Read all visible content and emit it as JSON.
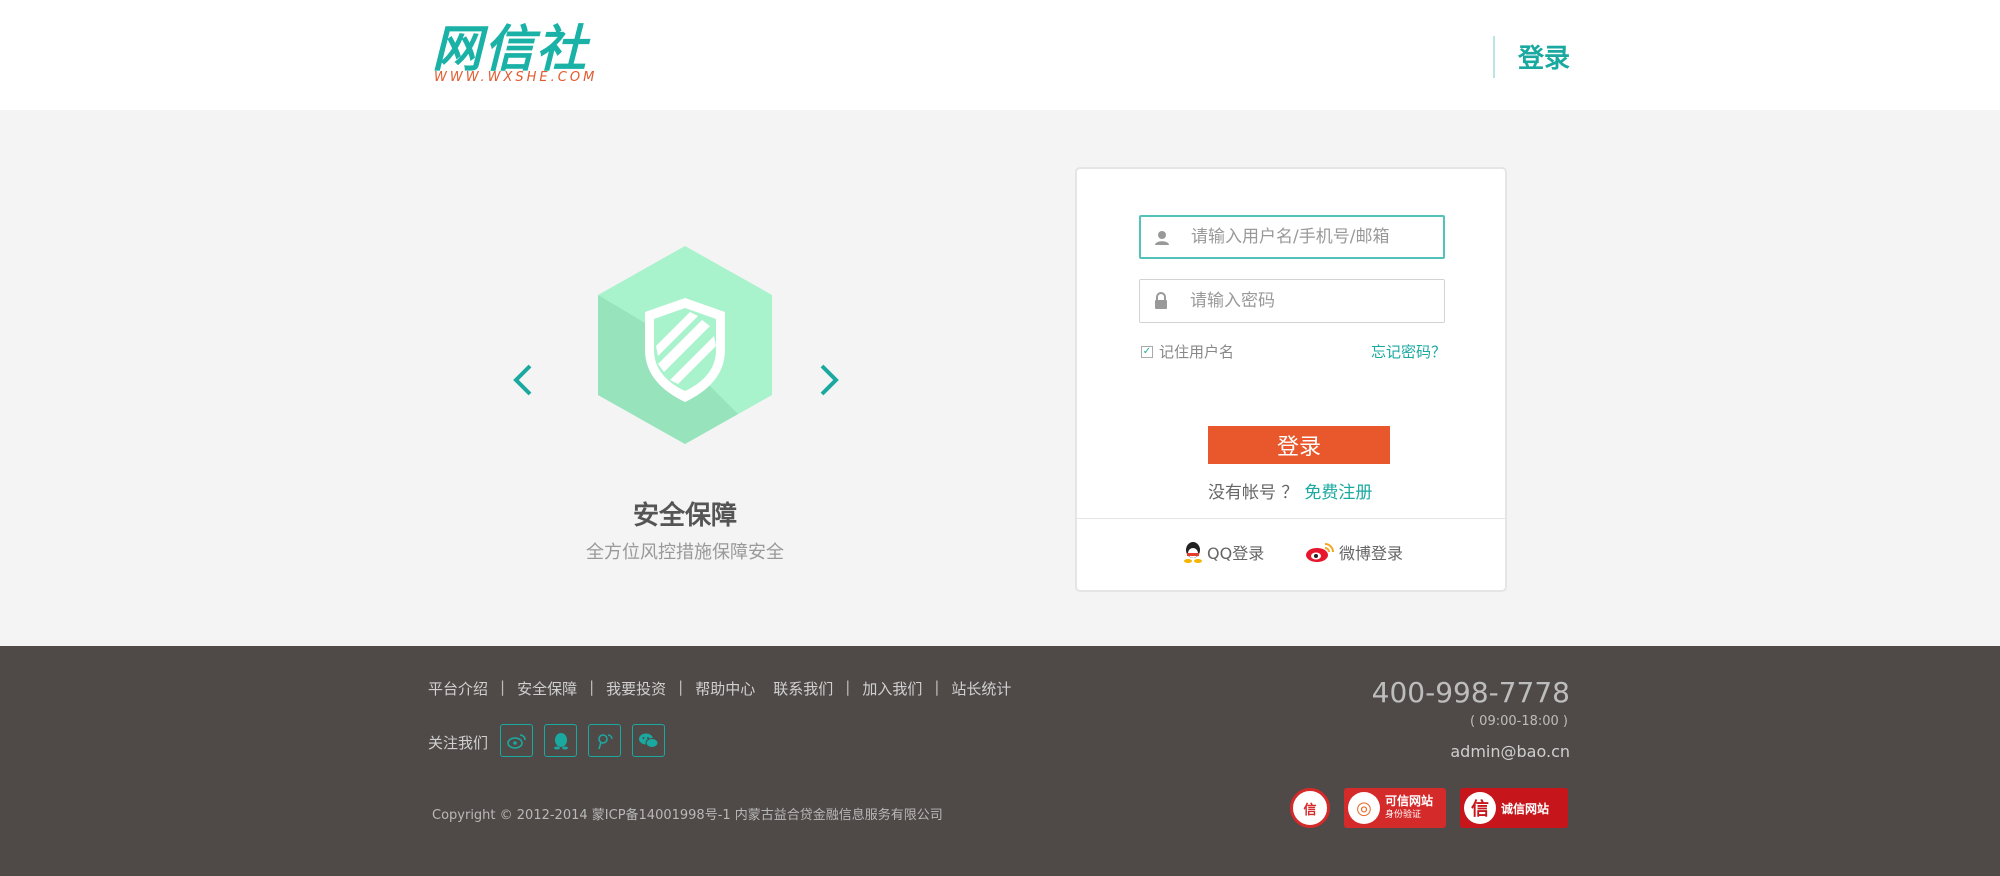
{
  "header": {
    "logo_text": "网信社",
    "logo_url_text": "WWW.WXSHE.COM",
    "login_label": "登录"
  },
  "slider": {
    "icon": "shield-icon",
    "title": "安全保障",
    "description": "全方位风控措施保障安全"
  },
  "login": {
    "username_placeholder": "请输入用户名/手机号/邮箱",
    "password_placeholder": "请输入密码",
    "remember_label": "记住用户名",
    "forgot_label": "忘记密码？",
    "submit_label": "登录",
    "no_account_text": "没有帐号 ？",
    "register_label": "免费注册",
    "qq_login_label": "QQ登录",
    "weibo_login_label": "微博登录"
  },
  "footer": {
    "nav": [
      "平台介绍",
      "安全保障",
      "我要投资",
      "帮助中心",
      "联系我们",
      "加入我们",
      "站长统计"
    ],
    "follow_label": "关注我们",
    "follow_icons": [
      "weibo-icon",
      "qq-icon",
      "tencent-weibo-icon",
      "wechat-icon"
    ],
    "copyright": "Copyright © 2012-2014 蒙ICP备14001998号-1 内蒙古益合贷金融信息服务有限公司",
    "phone": "400-998-7778",
    "hours": "( 09:00-18:00 )",
    "email": "admin@bao.cn",
    "badges": {
      "trust_text": "信",
      "credible_title": "可信网站",
      "credible_sub": "身份验证",
      "integrity_icon_text": "信",
      "integrity_title": "诚信网站"
    }
  },
  "colors": {
    "brand": "#1aa9a0",
    "button": "#e9582c",
    "footer_bg": "#4f4a48"
  }
}
